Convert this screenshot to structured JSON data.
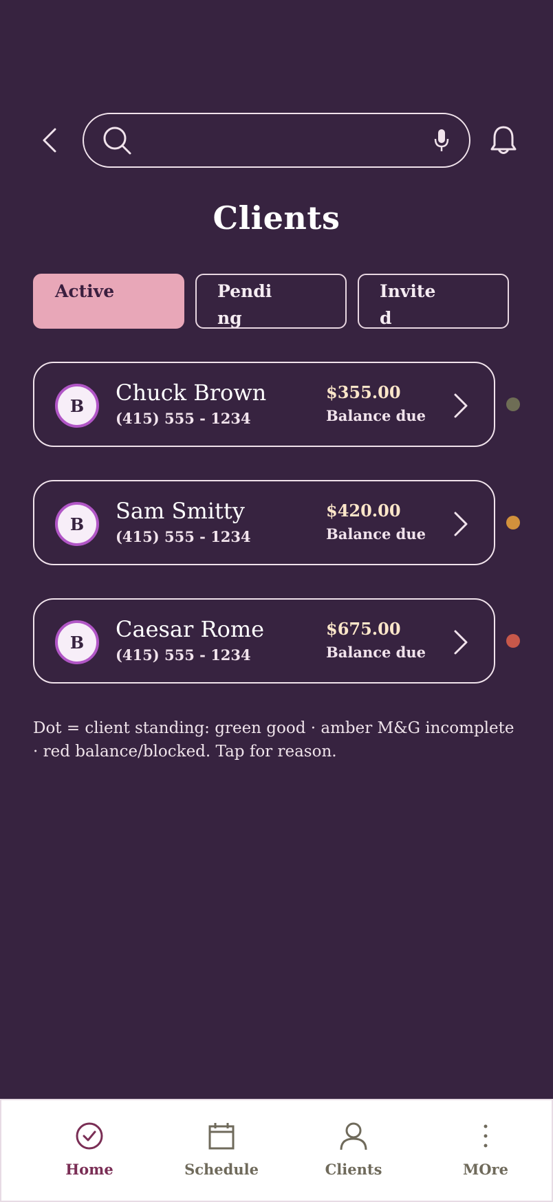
{
  "header": {
    "search_placeholder": "",
    "search_value": ""
  },
  "title": "Clients",
  "tabs": [
    {
      "label": "Active",
      "active": true
    },
    {
      "label": "Pending",
      "active": false
    },
    {
      "label": "Invited",
      "active": false
    }
  ],
  "clients": [
    {
      "initial": "B",
      "name": "Chuck Brown",
      "phone": "(415) 555 - 1234",
      "amount": "$355.00",
      "balance_label": "Balance due",
      "status_color": "#6e6d55"
    },
    {
      "initial": "B",
      "name": "Sam Smitty",
      "phone": "(415) 555 - 1234",
      "amount": "$420.00",
      "balance_label": "Balance due",
      "status_color": "#d2913c"
    },
    {
      "initial": "B",
      "name": "Caesar Rome",
      "phone": "(415) 555 - 1234",
      "amount": "$675.00",
      "balance_label": "Balance due",
      "status_color": "#c7584a"
    }
  ],
  "legend_note": "Dot = client standing: green good · amber M&G incomplete · red balance/blocked. Tap for reason.",
  "nav": [
    {
      "label": "Home",
      "icon": "check-circle-icon",
      "active": true
    },
    {
      "label": "Schedule",
      "icon": "calendar-icon",
      "active": false
    },
    {
      "label": "Clients",
      "icon": "person-icon",
      "active": false
    },
    {
      "label": "MOre",
      "icon": "more-vertical-icon",
      "active": false
    }
  ],
  "colors": {
    "background": "#372340",
    "active_tab": "#e8a7b8",
    "avatar_ring": "#b156c6",
    "nav_active": "#7a2e55",
    "nav_inactive": "#6f6a5b"
  }
}
